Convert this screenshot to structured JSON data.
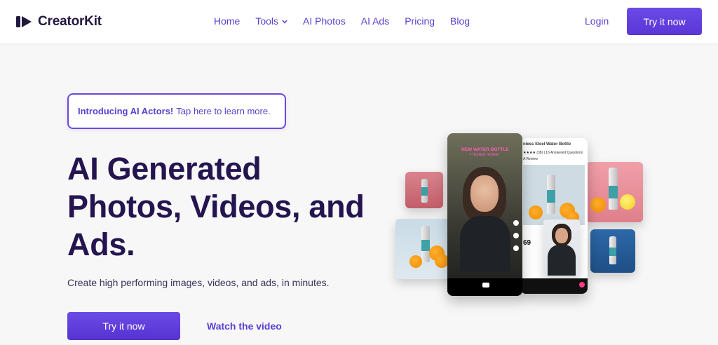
{
  "brand": {
    "name": "CreatorKit",
    "logo_icon": "play-logo-icon"
  },
  "nav": {
    "items": [
      {
        "label": "Home"
      },
      {
        "label": "Tools",
        "icon": "chevron-down-icon"
      },
      {
        "label": "AI Photos"
      },
      {
        "label": "AI Ads"
      },
      {
        "label": "Pricing"
      },
      {
        "label": "Blog"
      }
    ],
    "login": "Login",
    "cta": "Try it now"
  },
  "announcement": {
    "strong": "Introducing AI Actors!",
    "text": "Tap here to learn more."
  },
  "hero": {
    "title_lines": [
      "AI Generated",
      "Photos, Videos, and",
      "Ads."
    ],
    "subtitle": "Create high performing images, videos, and ads, in minutes.",
    "primary_cta": "Try it now",
    "secondary_cta": "Watch the video"
  },
  "collage": {
    "video_caption_line1": "NEW WATER BOTTLE",
    "video_caption_line2": "+ honest review",
    "product_title": "nless Steel Water Bottle",
    "rating_text": "(38) | 16 Answered Questions",
    "review_label": "A Review",
    "price": "69"
  },
  "colors": {
    "accent": "#5b3fd1",
    "heading": "#24154f",
    "background": "#f7f7f8"
  }
}
